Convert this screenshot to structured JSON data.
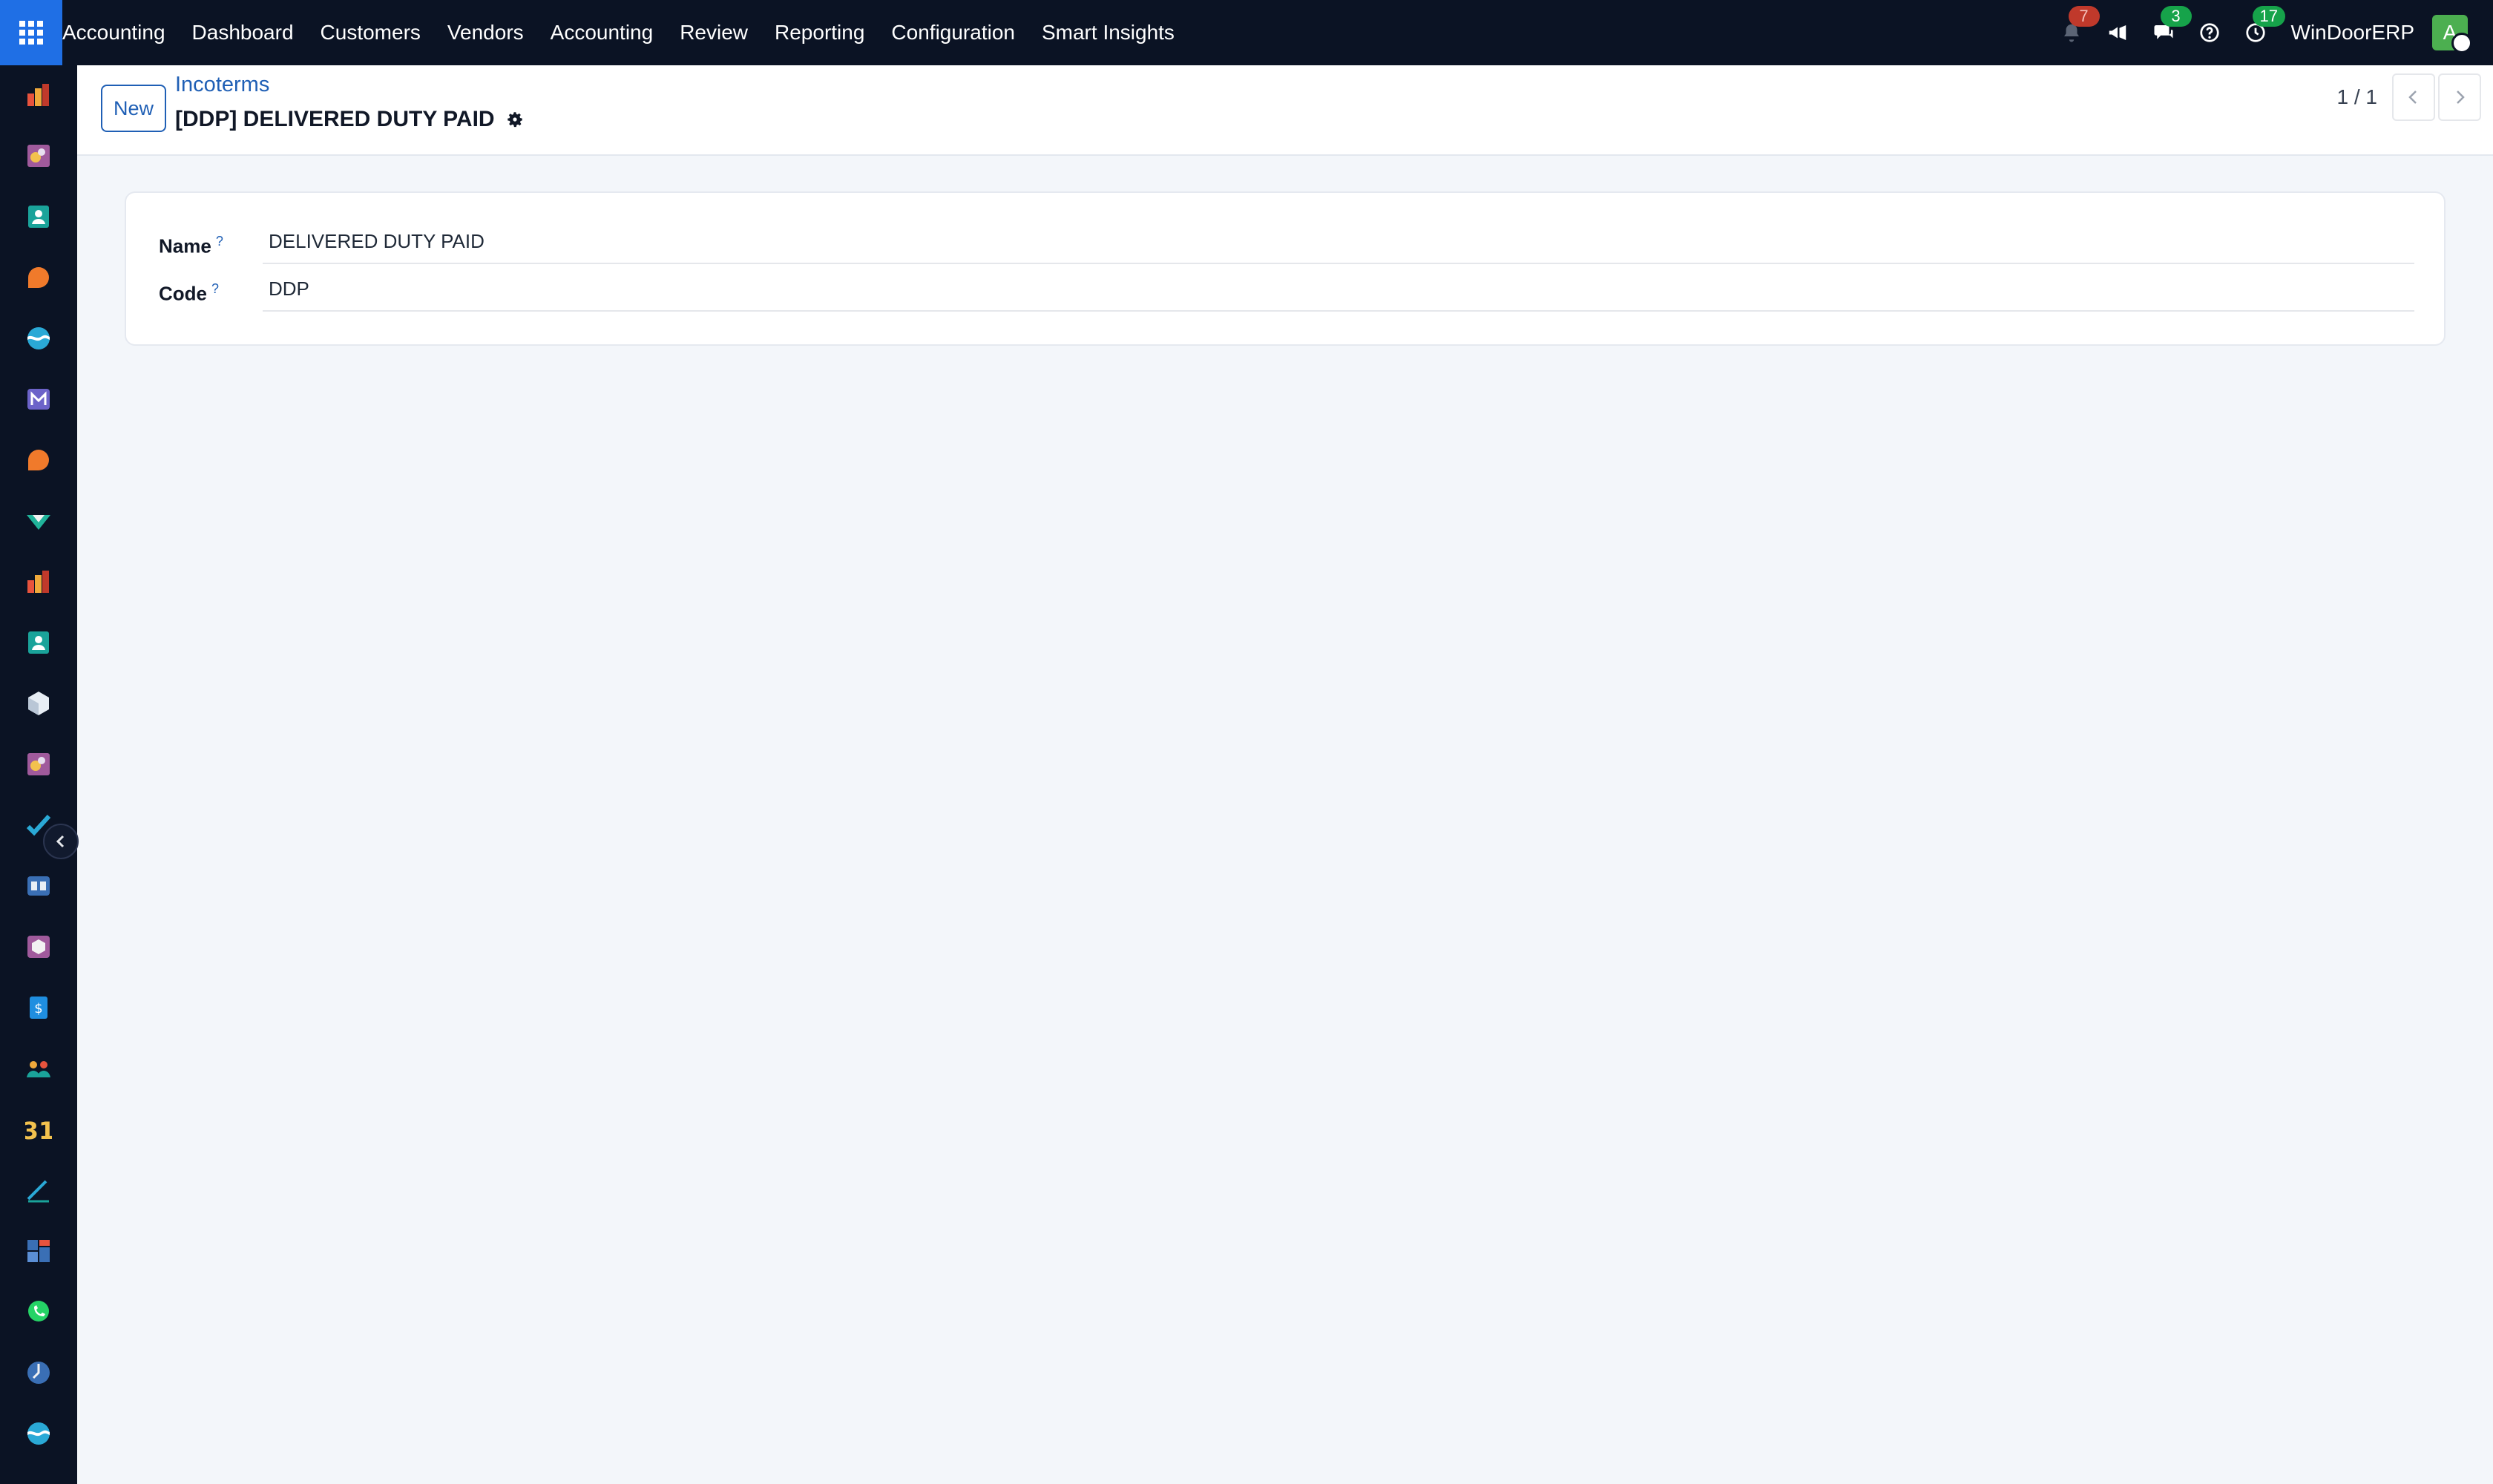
{
  "topbar": {
    "menu": [
      "Accounting",
      "Dashboard",
      "Customers",
      "Vendors",
      "Accounting",
      "Review",
      "Reporting",
      "Configuration",
      "Smart Insights"
    ],
    "notifications_count": "7",
    "messages_count": "3",
    "activities_count": "17",
    "company": "WinDoorERP",
    "avatar_initial": "A"
  },
  "sidebar": {
    "icons": [
      "invoicing-icon",
      "sales-icon",
      "contacts-icon",
      "discuss-icon",
      "website-icon",
      "email-marketing-icon",
      "livechat-icon",
      "project-icon",
      "invoicing-icon",
      "contacts-icon",
      "inventory-icon",
      "sales-icon",
      "todo-icon",
      "knowledge-icon",
      "purchase-icon",
      "accounting-icon",
      "employees-icon",
      "calendar-icon",
      "sign-icon",
      "dashboards-icon",
      "whatsapp-icon",
      "timesheets-icon",
      "website-icon"
    ],
    "calendar_number": "31"
  },
  "control_panel": {
    "new_label": "New",
    "breadcrumb": "Incoterms",
    "record_title": "[DDP] DELIVERED DUTY PAID",
    "pager": "1 / 1"
  },
  "form": {
    "fields": [
      {
        "label": "Name",
        "help": "?",
        "value": "DELIVERED DUTY PAID"
      },
      {
        "label": "Code",
        "help": "?",
        "value": "DDP"
      }
    ]
  },
  "colors": {
    "topbar": "#0b1324",
    "apps_button": "#1f6fe5",
    "link": "#1f5fb5",
    "background": "#f3f6fa"
  }
}
